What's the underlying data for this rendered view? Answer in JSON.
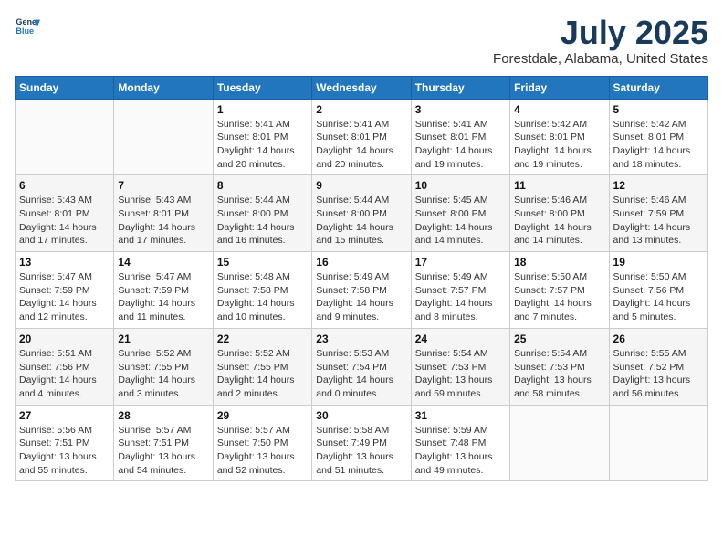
{
  "header": {
    "logo_line1": "General",
    "logo_line2": "Blue",
    "month_year": "July 2025",
    "location": "Forestdale, Alabama, United States"
  },
  "weekdays": [
    "Sunday",
    "Monday",
    "Tuesday",
    "Wednesday",
    "Thursday",
    "Friday",
    "Saturday"
  ],
  "weeks": [
    [
      {
        "day": "",
        "info": ""
      },
      {
        "day": "",
        "info": ""
      },
      {
        "day": "1",
        "info": "Sunrise: 5:41 AM\nSunset: 8:01 PM\nDaylight: 14 hours and 20 minutes."
      },
      {
        "day": "2",
        "info": "Sunrise: 5:41 AM\nSunset: 8:01 PM\nDaylight: 14 hours and 20 minutes."
      },
      {
        "day": "3",
        "info": "Sunrise: 5:41 AM\nSunset: 8:01 PM\nDaylight: 14 hours and 19 minutes."
      },
      {
        "day": "4",
        "info": "Sunrise: 5:42 AM\nSunset: 8:01 PM\nDaylight: 14 hours and 19 minutes."
      },
      {
        "day": "5",
        "info": "Sunrise: 5:42 AM\nSunset: 8:01 PM\nDaylight: 14 hours and 18 minutes."
      }
    ],
    [
      {
        "day": "6",
        "info": "Sunrise: 5:43 AM\nSunset: 8:01 PM\nDaylight: 14 hours and 17 minutes."
      },
      {
        "day": "7",
        "info": "Sunrise: 5:43 AM\nSunset: 8:01 PM\nDaylight: 14 hours and 17 minutes."
      },
      {
        "day": "8",
        "info": "Sunrise: 5:44 AM\nSunset: 8:00 PM\nDaylight: 14 hours and 16 minutes."
      },
      {
        "day": "9",
        "info": "Sunrise: 5:44 AM\nSunset: 8:00 PM\nDaylight: 14 hours and 15 minutes."
      },
      {
        "day": "10",
        "info": "Sunrise: 5:45 AM\nSunset: 8:00 PM\nDaylight: 14 hours and 14 minutes."
      },
      {
        "day": "11",
        "info": "Sunrise: 5:46 AM\nSunset: 8:00 PM\nDaylight: 14 hours and 14 minutes."
      },
      {
        "day": "12",
        "info": "Sunrise: 5:46 AM\nSunset: 7:59 PM\nDaylight: 14 hours and 13 minutes."
      }
    ],
    [
      {
        "day": "13",
        "info": "Sunrise: 5:47 AM\nSunset: 7:59 PM\nDaylight: 14 hours and 12 minutes."
      },
      {
        "day": "14",
        "info": "Sunrise: 5:47 AM\nSunset: 7:59 PM\nDaylight: 14 hours and 11 minutes."
      },
      {
        "day": "15",
        "info": "Sunrise: 5:48 AM\nSunset: 7:58 PM\nDaylight: 14 hours and 10 minutes."
      },
      {
        "day": "16",
        "info": "Sunrise: 5:49 AM\nSunset: 7:58 PM\nDaylight: 14 hours and 9 minutes."
      },
      {
        "day": "17",
        "info": "Sunrise: 5:49 AM\nSunset: 7:57 PM\nDaylight: 14 hours and 8 minutes."
      },
      {
        "day": "18",
        "info": "Sunrise: 5:50 AM\nSunset: 7:57 PM\nDaylight: 14 hours and 7 minutes."
      },
      {
        "day": "19",
        "info": "Sunrise: 5:50 AM\nSunset: 7:56 PM\nDaylight: 14 hours and 5 minutes."
      }
    ],
    [
      {
        "day": "20",
        "info": "Sunrise: 5:51 AM\nSunset: 7:56 PM\nDaylight: 14 hours and 4 minutes."
      },
      {
        "day": "21",
        "info": "Sunrise: 5:52 AM\nSunset: 7:55 PM\nDaylight: 14 hours and 3 minutes."
      },
      {
        "day": "22",
        "info": "Sunrise: 5:52 AM\nSunset: 7:55 PM\nDaylight: 14 hours and 2 minutes."
      },
      {
        "day": "23",
        "info": "Sunrise: 5:53 AM\nSunset: 7:54 PM\nDaylight: 14 hours and 0 minutes."
      },
      {
        "day": "24",
        "info": "Sunrise: 5:54 AM\nSunset: 7:53 PM\nDaylight: 13 hours and 59 minutes."
      },
      {
        "day": "25",
        "info": "Sunrise: 5:54 AM\nSunset: 7:53 PM\nDaylight: 13 hours and 58 minutes."
      },
      {
        "day": "26",
        "info": "Sunrise: 5:55 AM\nSunset: 7:52 PM\nDaylight: 13 hours and 56 minutes."
      }
    ],
    [
      {
        "day": "27",
        "info": "Sunrise: 5:56 AM\nSunset: 7:51 PM\nDaylight: 13 hours and 55 minutes."
      },
      {
        "day": "28",
        "info": "Sunrise: 5:57 AM\nSunset: 7:51 PM\nDaylight: 13 hours and 54 minutes."
      },
      {
        "day": "29",
        "info": "Sunrise: 5:57 AM\nSunset: 7:50 PM\nDaylight: 13 hours and 52 minutes."
      },
      {
        "day": "30",
        "info": "Sunrise: 5:58 AM\nSunset: 7:49 PM\nDaylight: 13 hours and 51 minutes."
      },
      {
        "day": "31",
        "info": "Sunrise: 5:59 AM\nSunset: 7:48 PM\nDaylight: 13 hours and 49 minutes."
      },
      {
        "day": "",
        "info": ""
      },
      {
        "day": "",
        "info": ""
      }
    ]
  ]
}
